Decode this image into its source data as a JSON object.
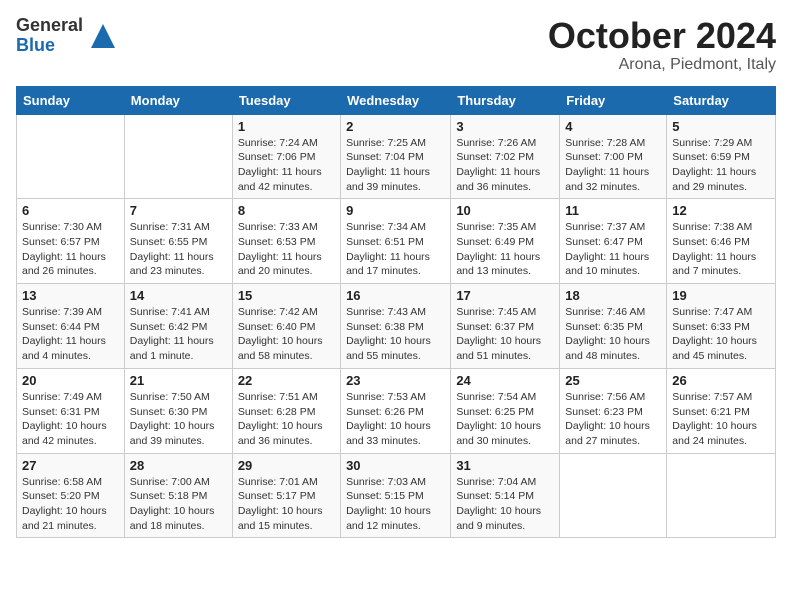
{
  "logo": {
    "general": "General",
    "blue": "Blue"
  },
  "title": "October 2024",
  "location": "Arona, Piedmont, Italy",
  "headers": [
    "Sunday",
    "Monday",
    "Tuesday",
    "Wednesday",
    "Thursday",
    "Friday",
    "Saturday"
  ],
  "weeks": [
    [
      {
        "day": "",
        "info": ""
      },
      {
        "day": "",
        "info": ""
      },
      {
        "day": "1",
        "info": "Sunrise: 7:24 AM\nSunset: 7:06 PM\nDaylight: 11 hours and 42 minutes."
      },
      {
        "day": "2",
        "info": "Sunrise: 7:25 AM\nSunset: 7:04 PM\nDaylight: 11 hours and 39 minutes."
      },
      {
        "day": "3",
        "info": "Sunrise: 7:26 AM\nSunset: 7:02 PM\nDaylight: 11 hours and 36 minutes."
      },
      {
        "day": "4",
        "info": "Sunrise: 7:28 AM\nSunset: 7:00 PM\nDaylight: 11 hours and 32 minutes."
      },
      {
        "day": "5",
        "info": "Sunrise: 7:29 AM\nSunset: 6:59 PM\nDaylight: 11 hours and 29 minutes."
      }
    ],
    [
      {
        "day": "6",
        "info": "Sunrise: 7:30 AM\nSunset: 6:57 PM\nDaylight: 11 hours and 26 minutes."
      },
      {
        "day": "7",
        "info": "Sunrise: 7:31 AM\nSunset: 6:55 PM\nDaylight: 11 hours and 23 minutes."
      },
      {
        "day": "8",
        "info": "Sunrise: 7:33 AM\nSunset: 6:53 PM\nDaylight: 11 hours and 20 minutes."
      },
      {
        "day": "9",
        "info": "Sunrise: 7:34 AM\nSunset: 6:51 PM\nDaylight: 11 hours and 17 minutes."
      },
      {
        "day": "10",
        "info": "Sunrise: 7:35 AM\nSunset: 6:49 PM\nDaylight: 11 hours and 13 minutes."
      },
      {
        "day": "11",
        "info": "Sunrise: 7:37 AM\nSunset: 6:47 PM\nDaylight: 11 hours and 10 minutes."
      },
      {
        "day": "12",
        "info": "Sunrise: 7:38 AM\nSunset: 6:46 PM\nDaylight: 11 hours and 7 minutes."
      }
    ],
    [
      {
        "day": "13",
        "info": "Sunrise: 7:39 AM\nSunset: 6:44 PM\nDaylight: 11 hours and 4 minutes."
      },
      {
        "day": "14",
        "info": "Sunrise: 7:41 AM\nSunset: 6:42 PM\nDaylight: 11 hours and 1 minute."
      },
      {
        "day": "15",
        "info": "Sunrise: 7:42 AM\nSunset: 6:40 PM\nDaylight: 10 hours and 58 minutes."
      },
      {
        "day": "16",
        "info": "Sunrise: 7:43 AM\nSunset: 6:38 PM\nDaylight: 10 hours and 55 minutes."
      },
      {
        "day": "17",
        "info": "Sunrise: 7:45 AM\nSunset: 6:37 PM\nDaylight: 10 hours and 51 minutes."
      },
      {
        "day": "18",
        "info": "Sunrise: 7:46 AM\nSunset: 6:35 PM\nDaylight: 10 hours and 48 minutes."
      },
      {
        "day": "19",
        "info": "Sunrise: 7:47 AM\nSunset: 6:33 PM\nDaylight: 10 hours and 45 minutes."
      }
    ],
    [
      {
        "day": "20",
        "info": "Sunrise: 7:49 AM\nSunset: 6:31 PM\nDaylight: 10 hours and 42 minutes."
      },
      {
        "day": "21",
        "info": "Sunrise: 7:50 AM\nSunset: 6:30 PM\nDaylight: 10 hours and 39 minutes."
      },
      {
        "day": "22",
        "info": "Sunrise: 7:51 AM\nSunset: 6:28 PM\nDaylight: 10 hours and 36 minutes."
      },
      {
        "day": "23",
        "info": "Sunrise: 7:53 AM\nSunset: 6:26 PM\nDaylight: 10 hours and 33 minutes."
      },
      {
        "day": "24",
        "info": "Sunrise: 7:54 AM\nSunset: 6:25 PM\nDaylight: 10 hours and 30 minutes."
      },
      {
        "day": "25",
        "info": "Sunrise: 7:56 AM\nSunset: 6:23 PM\nDaylight: 10 hours and 27 minutes."
      },
      {
        "day": "26",
        "info": "Sunrise: 7:57 AM\nSunset: 6:21 PM\nDaylight: 10 hours and 24 minutes."
      }
    ],
    [
      {
        "day": "27",
        "info": "Sunrise: 6:58 AM\nSunset: 5:20 PM\nDaylight: 10 hours and 21 minutes."
      },
      {
        "day": "28",
        "info": "Sunrise: 7:00 AM\nSunset: 5:18 PM\nDaylight: 10 hours and 18 minutes."
      },
      {
        "day": "29",
        "info": "Sunrise: 7:01 AM\nSunset: 5:17 PM\nDaylight: 10 hours and 15 minutes."
      },
      {
        "day": "30",
        "info": "Sunrise: 7:03 AM\nSunset: 5:15 PM\nDaylight: 10 hours and 12 minutes."
      },
      {
        "day": "31",
        "info": "Sunrise: 7:04 AM\nSunset: 5:14 PM\nDaylight: 10 hours and 9 minutes."
      },
      {
        "day": "",
        "info": ""
      },
      {
        "day": "",
        "info": ""
      }
    ]
  ]
}
